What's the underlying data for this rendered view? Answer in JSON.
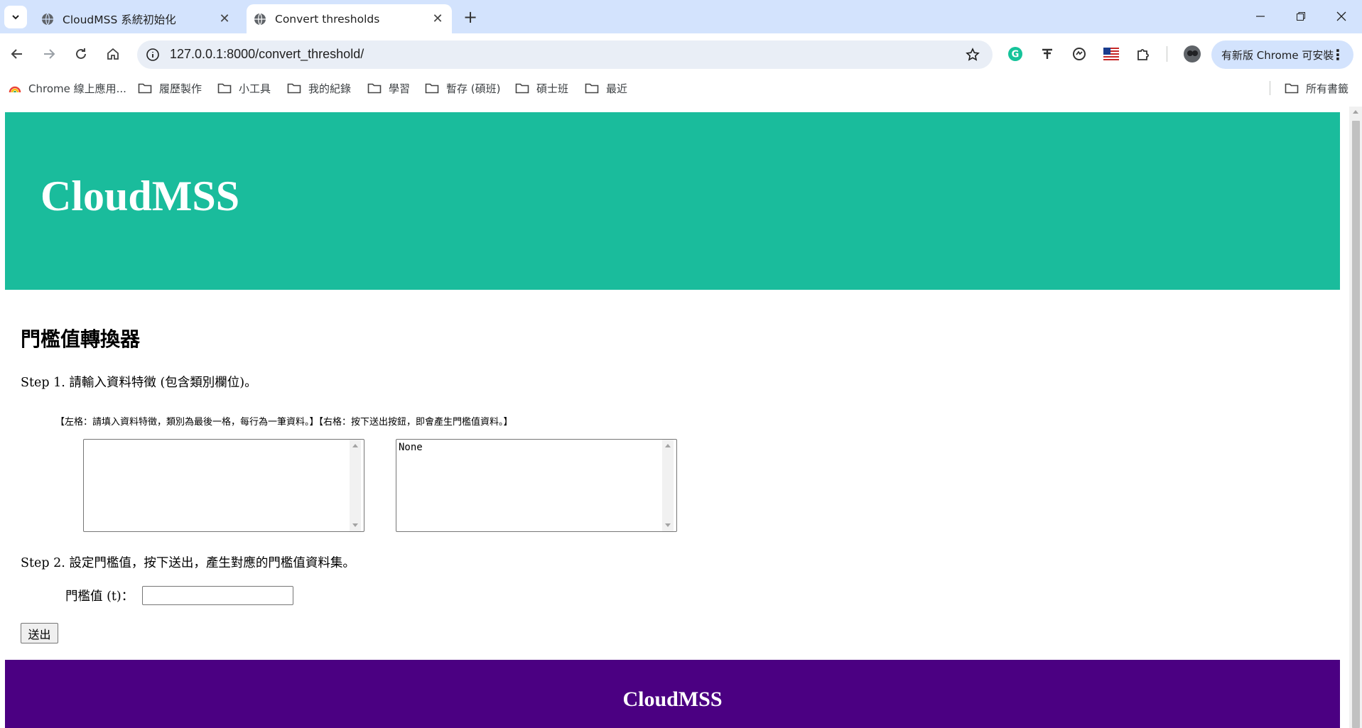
{
  "browser": {
    "tabs": [
      {
        "title": "CloudMSS 系統初始化",
        "active": false
      },
      {
        "title": "Convert thresholds",
        "active": true
      }
    ],
    "url": "127.0.0.1:8000/convert_threshold/",
    "update_label": "有新版 Chrome 可安裝",
    "bookmarks": [
      "Chrome 線上應用...",
      "履歷製作",
      "小工具",
      "我的紀錄",
      "學習",
      "暫存 (碩班)",
      "碩士班",
      "最近"
    ],
    "all_bookmarks": "所有書籤"
  },
  "page": {
    "header_title": "CloudMSS",
    "title": "門檻值轉換器",
    "step1": "Step 1. 請輸入資料特徵 (包含類別欄位)。",
    "hint": "【左格：請填入資料特徵，類別為最後一格，每行為一筆資料。】【右格：按下送出按鈕，即會產生門檻值資料。】",
    "left_textarea_value": "",
    "right_textarea_value": "None",
    "step2": "Step 2. 設定門檻值，按下送出，產生對應的門檻值資料集。",
    "threshold_label": "門檻值 (t)：",
    "threshold_value": "",
    "submit_label": "送出",
    "footer_title": "CloudMSS"
  },
  "colors": {
    "header_bg": "#1abc9c",
    "footer_bg": "#4b0082",
    "tabstrip_bg": "#d3e3fd"
  }
}
